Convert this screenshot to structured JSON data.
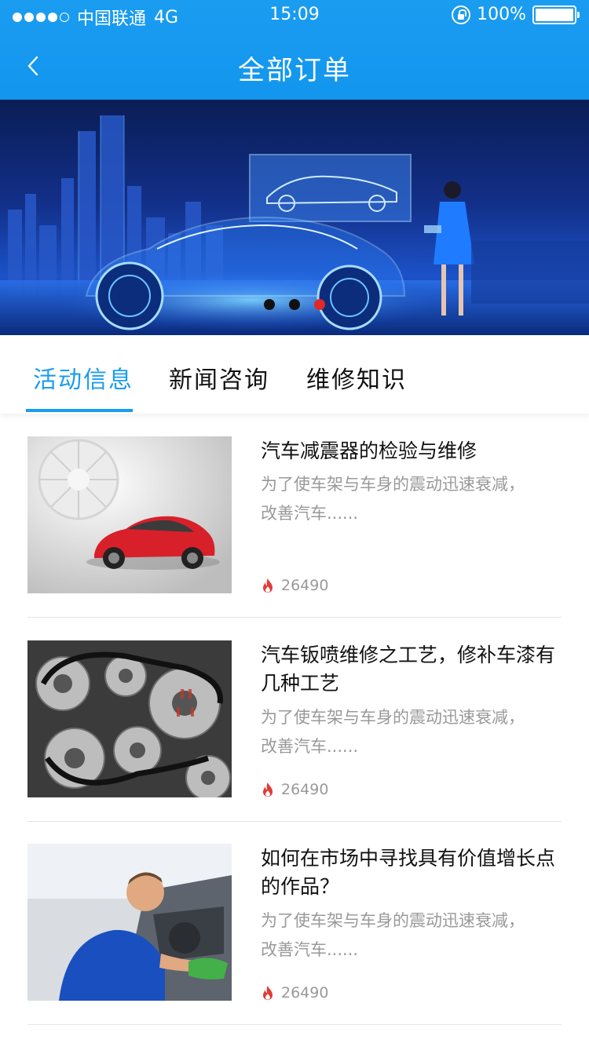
{
  "status_bar": {
    "carrier": "中国联通",
    "network": "4G",
    "time": "15:09",
    "battery": "100%",
    "signal_icon": "signal-dots-icon",
    "lock_icon": "rotation-lock-icon",
    "battery_icon": "battery-icon"
  },
  "navbar": {
    "title": "全部订单",
    "back_icon": "chevron-left-icon"
  },
  "banner": {
    "page_count": 3,
    "active_index": 2
  },
  "tabs": [
    {
      "label": "活动信息",
      "active": true
    },
    {
      "label": "新闻咨询",
      "active": false
    },
    {
      "label": "维修知识",
      "active": false
    }
  ],
  "articles": [
    {
      "title": "汽车减震器的检验与维修",
      "desc_line1": "为了使车架与车身的震动迅速衰减，",
      "desc_line2": "改善汽车......",
      "views": "26490",
      "image": "red-sports-car"
    },
    {
      "title": "汽车钣喷维修之工艺，修补车漆有几种工艺",
      "desc_line1": "为了使车架与车身的震动迅速衰减，",
      "desc_line2": "改善汽车......",
      "views": "26490",
      "image": "engine-belt-pulleys"
    },
    {
      "title": "如何在市场中寻找具有价值增长点的作品？",
      "desc_line1": "为了使车架与车身的震动迅速衰减，",
      "desc_line2": "改善汽车......",
      "views": "26490",
      "image": "mechanic-cleaning-car"
    }
  ],
  "colors": {
    "brand_blue": "#1a9cf0",
    "active_dot": "#e02828",
    "fire": "#e53935",
    "muted_text": "#999999"
  }
}
